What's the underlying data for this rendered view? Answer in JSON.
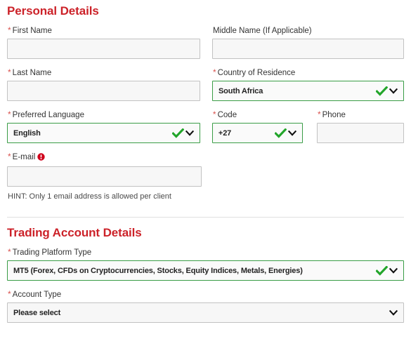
{
  "sections": [
    {
      "id": "personal-details",
      "title": "Personal Details"
    },
    {
      "id": "trading-account-details",
      "title": "Trading Account Details"
    }
  ],
  "personal": {
    "first_name": {
      "label": "First Name",
      "required_marker": "*",
      "value": "",
      "placeholder": ""
    },
    "middle_name": {
      "label": "Middle Name (If Applicable)",
      "required_marker": "",
      "value": "",
      "placeholder": ""
    },
    "last_name": {
      "label": "Last Name",
      "required_marker": "*",
      "value": "",
      "placeholder": ""
    },
    "country": {
      "label": "Country of Residence",
      "required_marker": "*",
      "value": "South Africa",
      "state": "valid"
    },
    "language": {
      "label": "Preferred Language",
      "required_marker": "*",
      "value": "English",
      "state": "valid"
    },
    "code": {
      "label": "Code",
      "required_marker": "*",
      "value": "+27",
      "state": "valid"
    },
    "phone": {
      "label": "Phone",
      "required_marker": "*",
      "value": "",
      "placeholder": ""
    },
    "email": {
      "label": "E-mail",
      "required_marker": "*",
      "value": "",
      "placeholder": "",
      "info_icon": "info-circle-icon"
    },
    "email_hint": "HINT: Only 1 email address is allowed per client"
  },
  "trading": {
    "platform_type": {
      "label": "Trading Platform Type",
      "required_marker": "*",
      "value": "MT5 (Forex, CFDs on Cryptocurrencies, Stocks, Equity Indices, Metals, Energies)",
      "state": "valid"
    },
    "account_type": {
      "label": "Account Type",
      "required_marker": "*",
      "value": "Please select",
      "state": "empty"
    }
  },
  "icons": {
    "check": "check-icon",
    "chevron": "chevron-down-icon",
    "info": "info-circle-icon"
  },
  "colors": {
    "heading_red": "#cc2229",
    "required_red": "#d9534f",
    "valid_green": "#3a9d46",
    "check_green": "#22a52a",
    "input_border": "#c2c2c2",
    "input_fill": "#f7f7f7",
    "divider": "#e0e0e0",
    "label_text": "#333333"
  }
}
